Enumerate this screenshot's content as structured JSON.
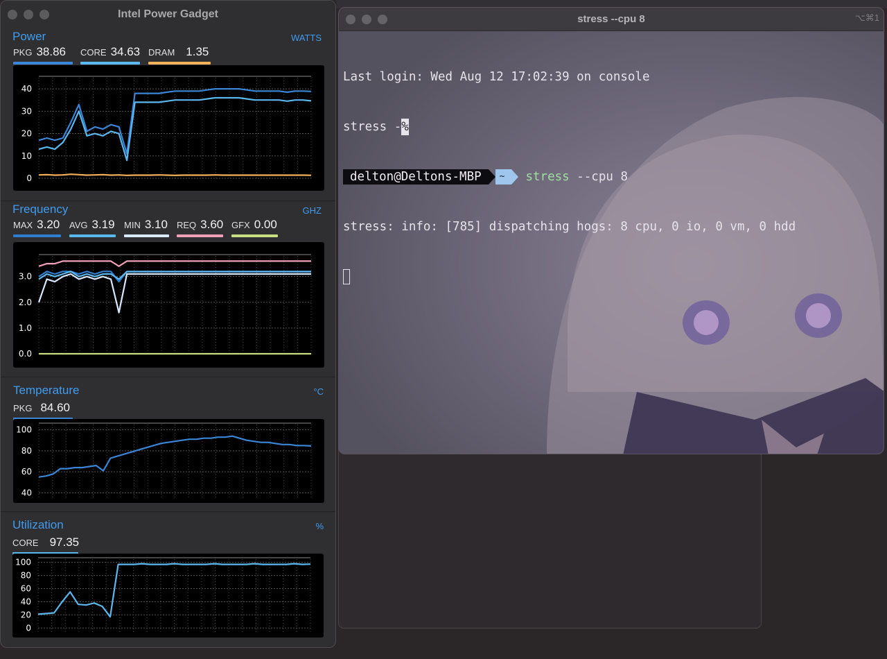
{
  "ipg": {
    "title": "Intel Power Gadget",
    "power": {
      "title": "Power",
      "unit": "WATTS",
      "metrics": [
        {
          "label": "PKG",
          "value": "38.86",
          "color": "#3a86d8"
        },
        {
          "label": "CORE",
          "value": "34.63",
          "color": "#5ab8ee"
        },
        {
          "label": "DRAM",
          "value": "1.35",
          "color": "#f5b15a"
        }
      ],
      "ticks": [
        "40",
        "30",
        "20",
        "10",
        "0"
      ]
    },
    "frequency": {
      "title": "Frequency",
      "unit": "GHZ",
      "metrics": [
        {
          "label": "MAX",
          "value": "3.20",
          "color": "#2f7fd0"
        },
        {
          "label": "AVG",
          "value": "3.19",
          "color": "#5ab8ee"
        },
        {
          "label": "MIN",
          "value": "3.10",
          "color": "#d8e8ff"
        },
        {
          "label": "REQ",
          "value": "3.60",
          "color": "#f0a0b8"
        },
        {
          "label": "GFX",
          "value": "0.00",
          "color": "#c8dc82"
        }
      ],
      "ticks": [
        "3.0",
        "2.0",
        "1.0",
        "0.0"
      ]
    },
    "temperature": {
      "title": "Temperature",
      "unit": "°C",
      "metrics": [
        {
          "label": "PKG",
          "value": "84.60",
          "color": "#3a86d8"
        }
      ],
      "ticks": [
        "100",
        "80",
        "60",
        "40"
      ]
    },
    "utilization": {
      "title": "Utilization",
      "unit": "%",
      "metrics": [
        {
          "label": "CORE",
          "value": "97.35",
          "color": "#5ab8ee"
        }
      ],
      "ticks": [
        "100",
        "80",
        "60",
        "40",
        "20",
        "0"
      ]
    }
  },
  "terminal": {
    "title": "stress --cpu 8",
    "shortcut": "⌥⌘1",
    "last_login": "Last login: Wed Aug 12 17:02:39 on console",
    "prev_cmd": "stress -",
    "prev_cursor": "%",
    "prompt_user": "delton@Deltons-MBP",
    "prompt_dir": "~",
    "cmd_name": "stress",
    "cmd_args": " --cpu 8",
    "output": "stress: info: [785] dispatching hogs: 8 cpu, 0 io, 0 vm, 0 hdd"
  },
  "chart_data": [
    {
      "type": "line",
      "title": "Power",
      "ylabel": "WATTS",
      "ylim": [
        0,
        45
      ],
      "grid": true,
      "series": [
        {
          "name": "PKG",
          "values": [
            17,
            18,
            17,
            18,
            25,
            33,
            21,
            23,
            22,
            24,
            23,
            11,
            38,
            38,
            38,
            38,
            38.5,
            39,
            39,
            39,
            39,
            39.5,
            40,
            40,
            40,
            40,
            39.5,
            39,
            39,
            39,
            39,
            38.5,
            39,
            39,
            38.86
          ]
        },
        {
          "name": "CORE",
          "values": [
            13,
            14,
            13,
            16,
            22,
            30,
            19,
            20,
            19,
            21,
            20,
            8,
            34,
            34,
            34,
            34,
            34.5,
            35,
            35,
            35,
            35,
            35.5,
            36,
            36,
            36,
            36,
            35.5,
            35,
            35,
            35,
            35,
            34.5,
            35,
            35,
            34.63
          ]
        },
        {
          "name": "DRAM",
          "values": [
            1.5,
            1.6,
            1.4,
            1.5,
            1.8,
            1.6,
            1.4,
            1.5,
            1.6,
            1.4,
            1.5,
            1.3,
            1.4,
            1.4,
            1.4,
            1.5,
            1.4,
            1.3,
            1.4,
            1.4,
            1.4,
            1.4,
            1.5,
            1.4,
            1.4,
            1.4,
            1.4,
            1.4,
            1.4,
            1.4,
            1.4,
            1.4,
            1.4,
            1.4,
            1.35
          ]
        }
      ]
    },
    {
      "type": "line",
      "title": "Frequency",
      "ylabel": "GHZ",
      "ylim": [
        0,
        3.8
      ],
      "grid": true,
      "series": [
        {
          "name": "REQ",
          "values": [
            3.4,
            3.5,
            3.5,
            3.6,
            3.6,
            3.6,
            3.6,
            3.6,
            3.6,
            3.6,
            3.4,
            3.6,
            3.6,
            3.6,
            3.6,
            3.6,
            3.6,
            3.6,
            3.6,
            3.6,
            3.6,
            3.6,
            3.6,
            3.6,
            3.6,
            3.6,
            3.6,
            3.6,
            3.6,
            3.6,
            3.6,
            3.6,
            3.6,
            3.6,
            3.6
          ]
        },
        {
          "name": "MAX",
          "values": [
            3.0,
            3.2,
            3.1,
            3.2,
            3.2,
            3.1,
            3.2,
            3.1,
            3.2,
            3.2,
            2.8,
            3.2,
            3.2,
            3.2,
            3.2,
            3.2,
            3.2,
            3.2,
            3.2,
            3.2,
            3.2,
            3.2,
            3.2,
            3.2,
            3.2,
            3.2,
            3.2,
            3.2,
            3.2,
            3.2,
            3.2,
            3.2,
            3.2,
            3.2,
            3.2
          ]
        },
        {
          "name": "AVG",
          "values": [
            2.9,
            3.1,
            3.0,
            3.1,
            3.2,
            3.0,
            3.1,
            3.0,
            3.1,
            3.1,
            2.9,
            3.19,
            3.19,
            3.19,
            3.19,
            3.19,
            3.19,
            3.19,
            3.19,
            3.19,
            3.19,
            3.19,
            3.19,
            3.19,
            3.19,
            3.19,
            3.19,
            3.19,
            3.19,
            3.19,
            3.19,
            3.19,
            3.19,
            3.19,
            3.19
          ]
        },
        {
          "name": "MIN",
          "values": [
            2.0,
            2.9,
            2.8,
            3.0,
            3.1,
            2.9,
            3.0,
            2.9,
            3.0,
            2.9,
            1.6,
            3.1,
            3.1,
            3.1,
            3.1,
            3.1,
            3.1,
            3.1,
            3.1,
            3.1,
            3.1,
            3.1,
            3.1,
            3.1,
            3.1,
            3.1,
            3.1,
            3.1,
            3.1,
            3.1,
            3.1,
            3.1,
            3.1,
            3.1,
            3.1
          ]
        },
        {
          "name": "GFX",
          "values": [
            0,
            0,
            0,
            0,
            0,
            0,
            0,
            0,
            0,
            0,
            0,
            0,
            0,
            0,
            0,
            0,
            0,
            0,
            0,
            0,
            0,
            0,
            0,
            0,
            0,
            0,
            0,
            0,
            0,
            0,
            0,
            0,
            0,
            0,
            0
          ]
        }
      ]
    },
    {
      "type": "line",
      "title": "Temperature",
      "ylabel": "°C",
      "ylim": [
        35,
        105
      ],
      "grid": true,
      "series": [
        {
          "name": "PKG",
          "values": [
            55,
            56,
            58,
            63,
            63,
            64,
            64,
            65,
            66,
            61,
            73,
            75,
            77,
            79,
            81,
            83,
            85,
            87,
            88,
            89,
            90,
            91,
            91,
            92,
            92,
            93,
            93,
            94,
            92,
            90,
            89,
            88,
            88,
            87,
            86,
            86,
            85,
            85,
            84.6
          ]
        }
      ]
    },
    {
      "type": "line",
      "title": "Utilization",
      "ylabel": "%",
      "ylim": [
        -5,
        105
      ],
      "grid": true,
      "series": [
        {
          "name": "CORE",
          "values": [
            21,
            22,
            23,
            40,
            55,
            36,
            35,
            38,
            33,
            17,
            97,
            97,
            97,
            98,
            97,
            97,
            97,
            98,
            97,
            97,
            97,
            97,
            98,
            97,
            97,
            97,
            97,
            98,
            97,
            97,
            97,
            97,
            98,
            97,
            97.35
          ]
        }
      ]
    }
  ]
}
